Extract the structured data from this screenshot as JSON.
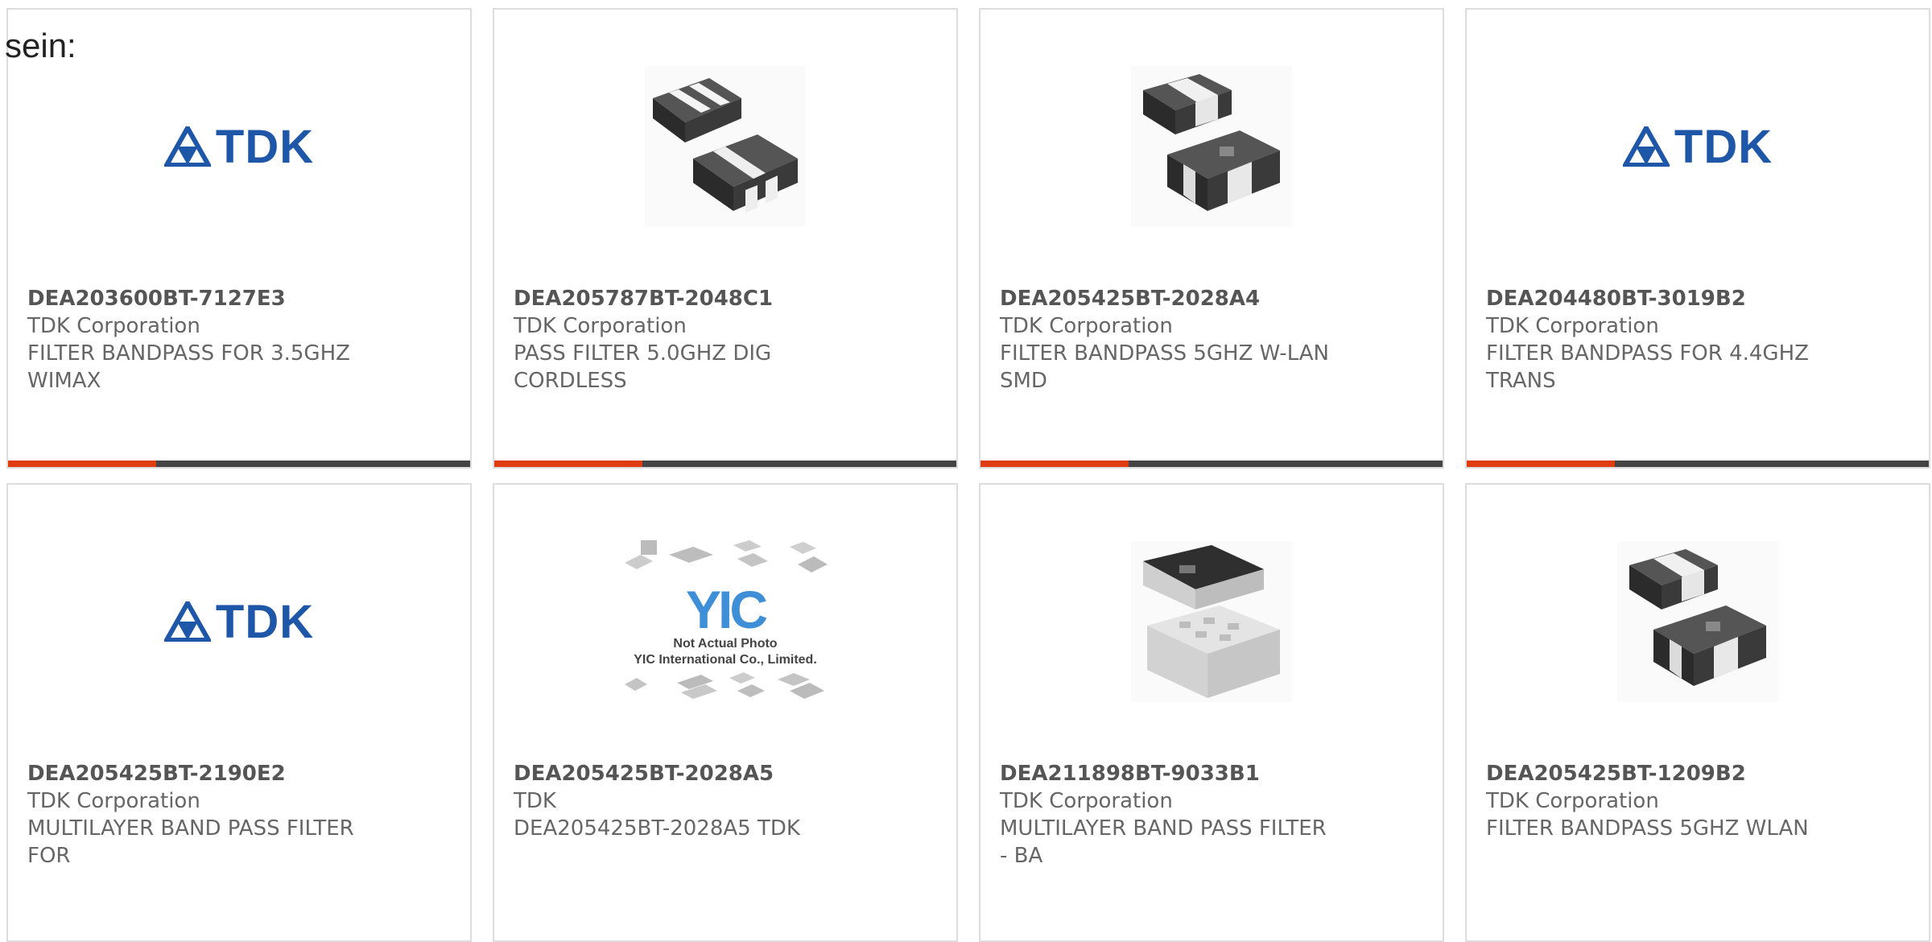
{
  "page": {
    "heading": "sein:"
  },
  "cards": [
    {
      "part": "DEA203600BT-7127E3",
      "maker": "TDK Corporation",
      "desc1": "FILTER BANDPASS FOR 3.5GHZ",
      "desc2": "WIMAX",
      "image": "tdk-logo",
      "logo_text": "TDK"
    },
    {
      "part": "DEA205787BT-2048C1",
      "maker": "TDK Corporation",
      "desc1": "PASS FILTER 5.0GHZ DIG",
      "desc2": "CORDLESS",
      "image": "chip-photo"
    },
    {
      "part": "DEA205425BT-2028A4",
      "maker": "TDK Corporation",
      "desc1": "FILTER BANDPASS 5GHZ W-LAN",
      "desc2": "SMD",
      "image": "chip-photo"
    },
    {
      "part": "DEA204480BT-3019B2",
      "maker": "TDK Corporation",
      "desc1": "FILTER BANDPASS FOR 4.4GHZ",
      "desc2": "TRANS",
      "image": "tdk-logo",
      "logo_text": "TDK"
    },
    {
      "part": "DEA205425BT-2190E2",
      "maker": "TDK Corporation",
      "desc1": "MULTILAYER BAND PASS FILTER",
      "desc2": "FOR",
      "image": "tdk-logo",
      "logo_text": "TDK"
    },
    {
      "part": "DEA205425BT-2028A5",
      "maker": "TDK",
      "desc1": "DEA205425BT-2028A5 TDK",
      "desc2": "",
      "image": "placeholder-photo",
      "placeholder_logo": "YIC",
      "placeholder_line1": "Not Actual Photo",
      "placeholder_line2": "YIC International Co., Limited."
    },
    {
      "part": "DEA211898BT-9033B1",
      "maker": "TDK Corporation",
      "desc1": "MULTILAYER BAND PASS FILTER",
      "desc2": "- BA",
      "image": "chip-photo"
    },
    {
      "part": "DEA205425BT-1209B2",
      "maker": "TDK Corporation",
      "desc1": "FILTER BANDPASS 5GHZ WLAN",
      "desc2": "",
      "image": "chip-photo"
    }
  ],
  "colors": {
    "accent": "#e03c12",
    "bar": "#444444",
    "brand": "#1e56a8",
    "border": "#dddddd"
  }
}
